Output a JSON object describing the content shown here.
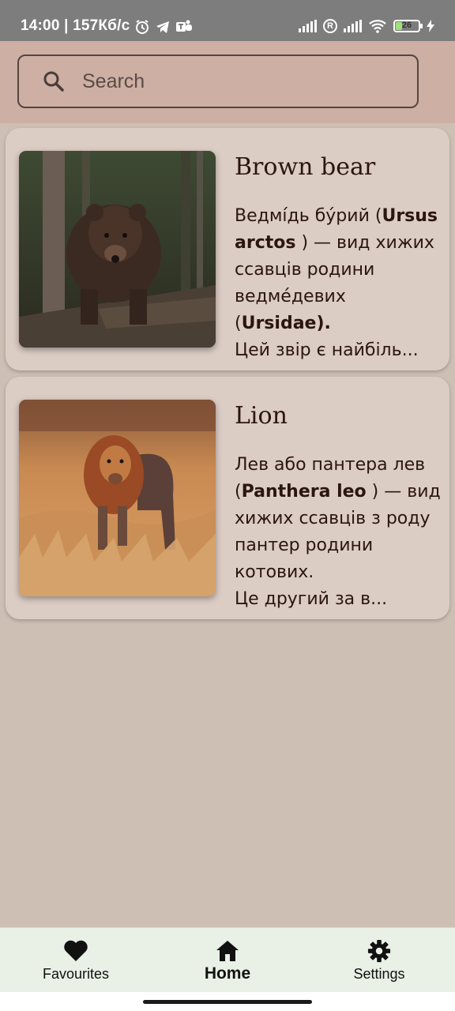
{
  "status_bar": {
    "time_speed": "14:00 | 157Кб/с",
    "battery": "26",
    "icons": [
      "alarm-icon",
      "telegram-icon",
      "teams-icon",
      "signal-icon",
      "registered-icon",
      "signal-icon",
      "wifi-icon",
      "battery-icon",
      "charging-icon"
    ]
  },
  "search": {
    "placeholder": "Search",
    "icon": "search-icon"
  },
  "animals": [
    {
      "title": "Brown bear",
      "desc_1": "Ведмі́дь бу́рий (",
      "latin": "Ursus arctos",
      "desc_2": " ) — вид хижих ссавців родини ведме́девих (",
      "family": "Ursidae).",
      "desc_3": "Цей звір є найбіль..."
    },
    {
      "title": "Lion",
      "desc_1": "Лев або пантера лев (",
      "latin": "Panthera leo",
      "desc_2": " ) — вид хижих ссавців з роду пантер родини котових.",
      "desc_3": "Це другий за в..."
    }
  ],
  "nav": {
    "items": [
      {
        "label": "Favourites",
        "icon": "heart-icon",
        "active": false
      },
      {
        "label": "Home",
        "icon": "home-icon",
        "active": true
      },
      {
        "label": "Settings",
        "icon": "gear-icon",
        "active": false
      }
    ]
  },
  "colors": {
    "background": "#cebfb5",
    "search_bar": "#cdafa3",
    "card": "#dbccc4",
    "text": "#2b160e",
    "nav_bar": "#e9f0e6"
  }
}
